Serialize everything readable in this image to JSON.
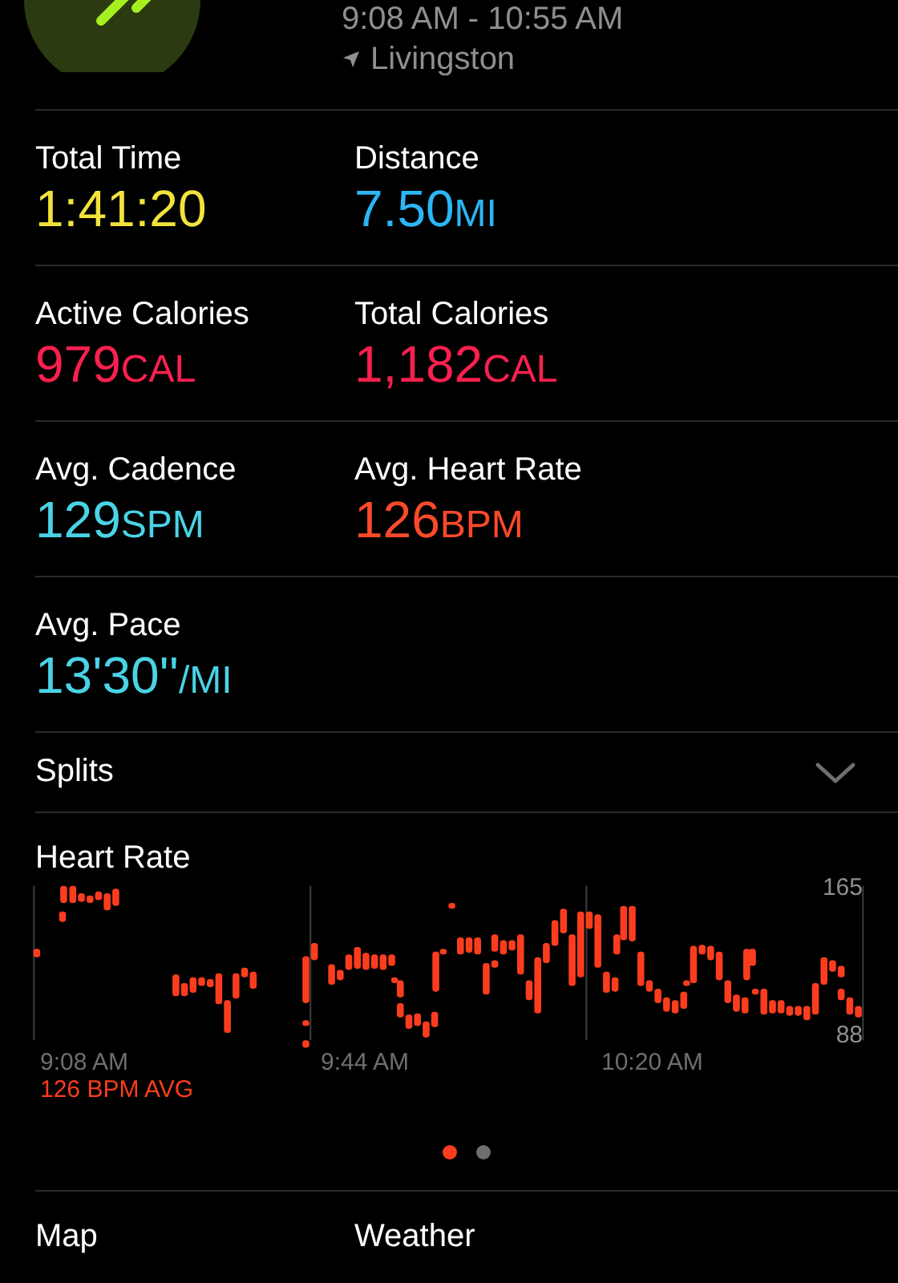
{
  "header": {
    "time_range": "9:08 AM - 10:55 AM",
    "location": "Livingston"
  },
  "metric_rows": [
    {
      "cells": [
        {
          "label": "Total Time",
          "value": "1:41:20",
          "color": "#f2e33c"
        },
        {
          "label": "Distance",
          "value": "7.50",
          "unit": "MI",
          "color": "#2bb6f5"
        }
      ]
    },
    {
      "cells": [
        {
          "label": "Active Calories",
          "value": "979",
          "unit": "CAL",
          "color": "#f9204f"
        },
        {
          "label": "Total Calories",
          "value": "1,182",
          "unit": "CAL",
          "color": "#f9204f"
        }
      ]
    },
    {
      "cells": [
        {
          "label": "Avg. Cadence",
          "value": "129",
          "unit": "SPM",
          "color": "#4ad3e6"
        },
        {
          "label": "Avg. Heart Rate",
          "value": "126",
          "unit": "BPM",
          "color": "#fb4a2a"
        }
      ]
    },
    {
      "cells": [
        {
          "label": "Avg. Pace",
          "value": "13'30''",
          "unit": "/MI",
          "color": "#4ad3e6"
        }
      ]
    }
  ],
  "splits": {
    "label": "Splits",
    "expanded": false
  },
  "heart_rate": {
    "title": "Heart Rate",
    "y_max_label": "165",
    "y_min_label": "88",
    "time_labels": [
      "9:08 AM",
      "9:44 AM",
      "10:20 AM"
    ],
    "average": "126 BPM AVG"
  },
  "page_dots": [
    {
      "selected": true
    },
    {
      "selected": false
    }
  ],
  "bottom_sections": [
    "Map",
    "Weather"
  ]
}
